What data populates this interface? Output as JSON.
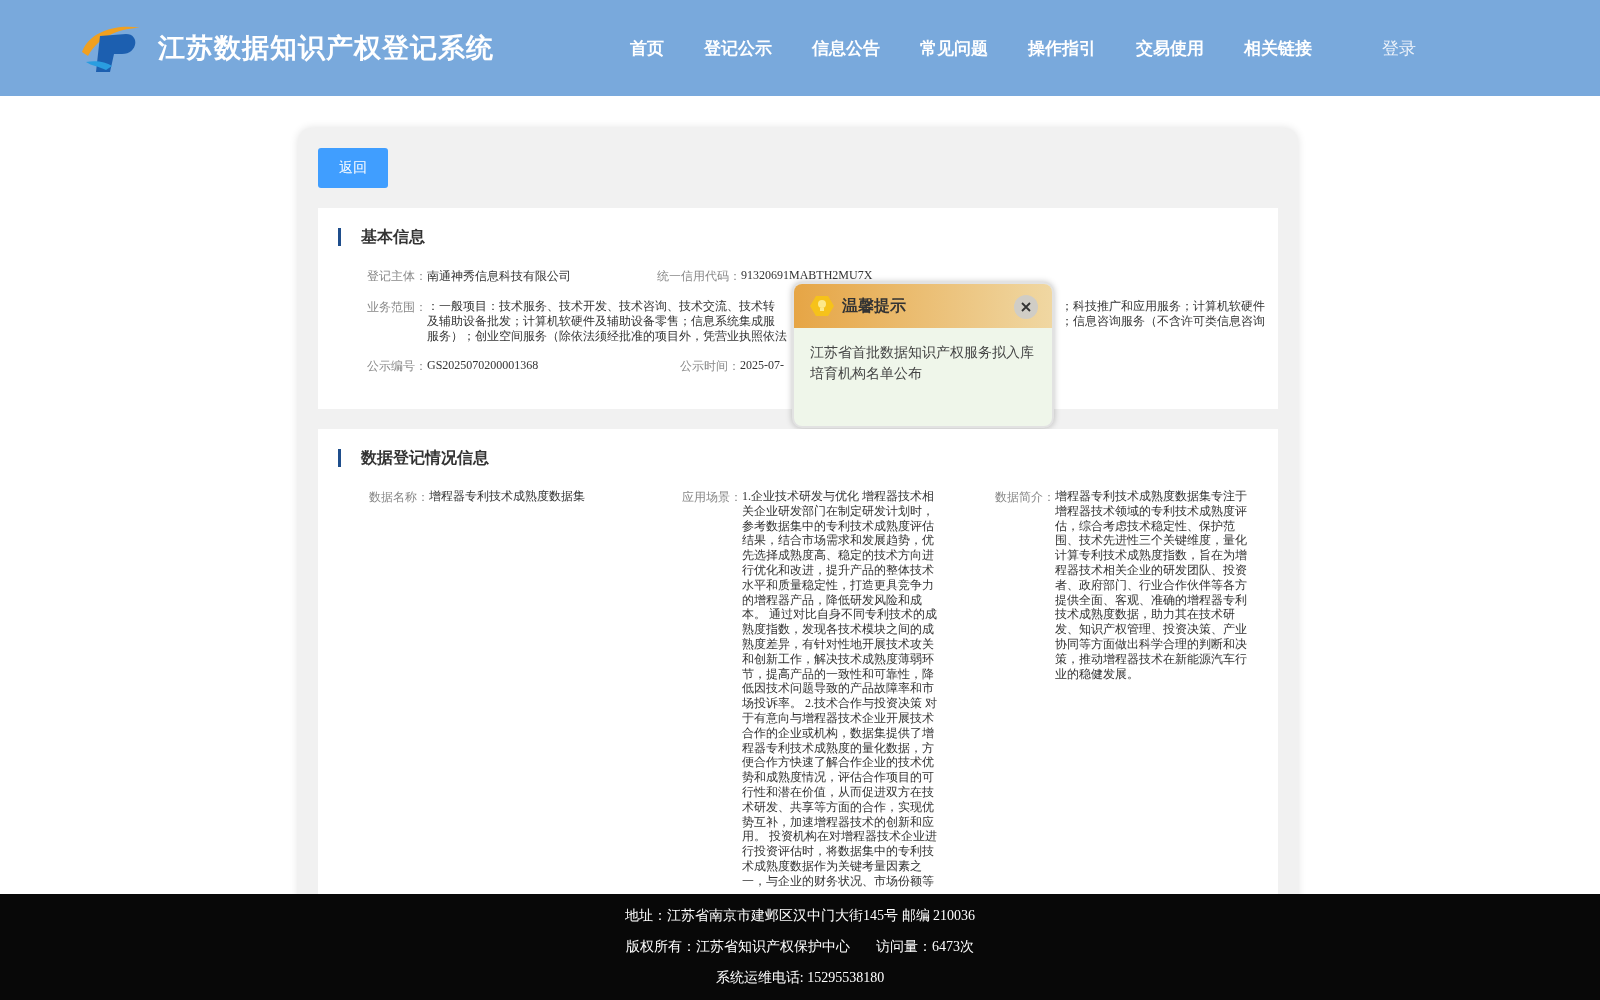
{
  "header": {
    "title": "江苏数据知识产权登记系统",
    "nav": [
      {
        "label": "首页"
      },
      {
        "label": "登记公示"
      },
      {
        "label": "信息公告"
      },
      {
        "label": "常见问题"
      },
      {
        "label": "操作指引"
      },
      {
        "label": "交易使用"
      },
      {
        "label": "相关链接"
      }
    ],
    "login": "登录"
  },
  "back_button": "返回",
  "basic_info": {
    "title": "基本信息",
    "subject": {
      "label": "登记主体：",
      "value": "南通神秀信息科技有限公司"
    },
    "credit_code": {
      "label": "统一信用代码：",
      "value": "91320691MABTH2MU7X"
    },
    "scope": {
      "label": "业务范围：",
      "lines": [
        {
          "start": "：一般项目：技术服务、技术开发、技术咨询、技术交流、技术转",
          "end": "；科技推广和应用服务；计算机软硬件"
        },
        {
          "start": "及辅助设备批发；计算机软硬件及辅助设备零售；信息系统集成服",
          "end": "；信息咨询服务（不含许可类信息咨询"
        },
        {
          "start": "服务）；创业空间服务（除依法须经批准的项目外，凭营业执照依法"
        }
      ]
    },
    "notice_no": {
      "label": "公示编号：",
      "value": "GS2025070200001368"
    },
    "notice_time": {
      "label": "公示时间：",
      "value": "2025-07-"
    }
  },
  "data_info": {
    "title": "数据登记情况信息",
    "fields": [
      {
        "label": "数据名称：",
        "value": "增程器专利技术成熟度数据集"
      },
      {
        "label": "应用场景：",
        "value": "1.企业技术研发与优化 增程器技术相关企业研发部门在制定研发计划时，参考数据集中的专利技术成熟度评估结果，结合市场需求和发展趋势，优先选择成熟度高、稳定的技术方向进行优化和改进，提升产品的整体技术水平和质量稳定性，打造更具竞争力的增程器产品，降低研发风险和成本。 通过对比自身不同专利技术的成熟度指数，发现各技术模块之间的成熟度差异，有针对性地开展技术攻关和创新工作，解决技术成熟度薄弱环节，提高产品的一致性和可靠性，降低因技术问题导致的产品故障率和市场投诉率。 2.技术合作与投资决策 对于有意向与增程器技术企业开展技术合作的企业或机构，数据集提供了增程器专利技术成熟度的量化数据，方便合作方快速了解合作企业的技术优势和成熟度情况，评估合作项目的可行性和潜在价值，从而促进双方在技术研发、共享等方面的合作，实现优势互补，加速增程器技术的创新和应用。 投资机构在对增程器技术企业进行投资评估时，将数据集中的专利技术成熟度数据作为关键考量因素之一，与企业的财务状况、市场份额等"
      },
      {
        "label": "数据简介：",
        "value": "增程器专利技术成熟度数据集专注于增程器技术领域的专利技术成熟度评估，综合考虑技术稳定性、保护范围、技术先进性三个关键维度，量化计算专利技术成熟度指数，旨在为增程器技术相关企业的研发团队、投资者、政府部门、行业合作伙伴等各方提供全面、客观、准确的增程器专利技术成熟度数据，助力其在技术研发、知识产权管理、投资决策、产业协同等方面做出科学合理的判断和决策，推动增程器技术在新能源汽车行业的稳健发展。"
      }
    ]
  },
  "popup": {
    "title": "温馨提示",
    "message": "江苏省首批数据知识产权服务拟入库培育机构名单公布"
  },
  "footer": {
    "address": "地址：江苏省南京市建邺区汉中门大街145号 邮编 210036",
    "copyright": "版权所有：江苏省知识产权保护中心",
    "visits": "访问量：6473次",
    "phone": "系统运维电话: 15295538180"
  }
}
